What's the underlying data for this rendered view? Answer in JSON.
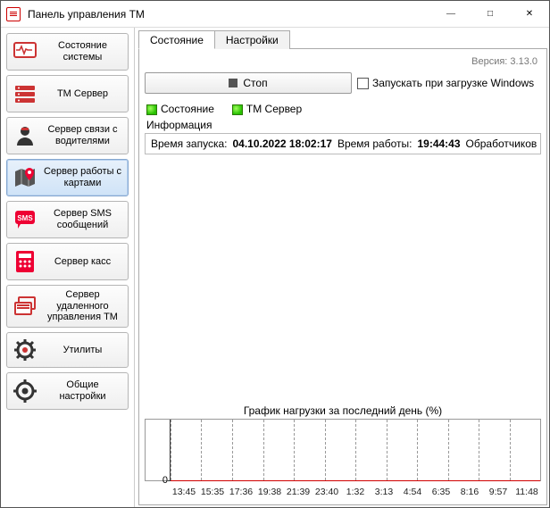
{
  "window": {
    "title": "Панель управления TM"
  },
  "sidebar": {
    "items": [
      {
        "label": "Состояние системы"
      },
      {
        "label": "TM Сервер"
      },
      {
        "label": "Сервер связи с водителями"
      },
      {
        "label": "Сервер работы с картами"
      },
      {
        "label": "Сервер SMS сообщений"
      },
      {
        "label": "Сервер касс"
      },
      {
        "label": "Сервер удаленного управления TM"
      },
      {
        "label": "Утилиты"
      },
      {
        "label": "Общие настройки"
      }
    ]
  },
  "tabs": {
    "state": "Состояние",
    "settings": "Настройки"
  },
  "version_label": "Версия: 3.13.0",
  "controls": {
    "stop_label": "Стоп",
    "autostart_label": "Запускать при загрузке Windows"
  },
  "status": {
    "state_label": "Состояние",
    "tm_server_label": "TM Сервер",
    "info_label": "Информация",
    "start_time_label": "Время запуска:",
    "start_time_value": "04.10.2022 18:02:17",
    "uptime_label": "Время работы:",
    "uptime_value": "19:44:43",
    "handlers_label": "Обработчиков за"
  },
  "chart_data": {
    "type": "line",
    "title": "График нагрузки за последний день (%)",
    "ylabel": "",
    "xlabel": "",
    "ylim": [
      0,
      100
    ],
    "y_ticks_shown": [
      0
    ],
    "categories": [
      "13:45",
      "15:35",
      "17:36",
      "19:38",
      "21:39",
      "23:40",
      "1:32",
      "3:13",
      "4:54",
      "6:35",
      "8:16",
      "9:57",
      "11:48"
    ],
    "series": [
      {
        "name": "load",
        "values": [
          0,
          0,
          0,
          0,
          0,
          0,
          0,
          0,
          0,
          0,
          0,
          0,
          0
        ],
        "color": "#d00000"
      }
    ]
  }
}
